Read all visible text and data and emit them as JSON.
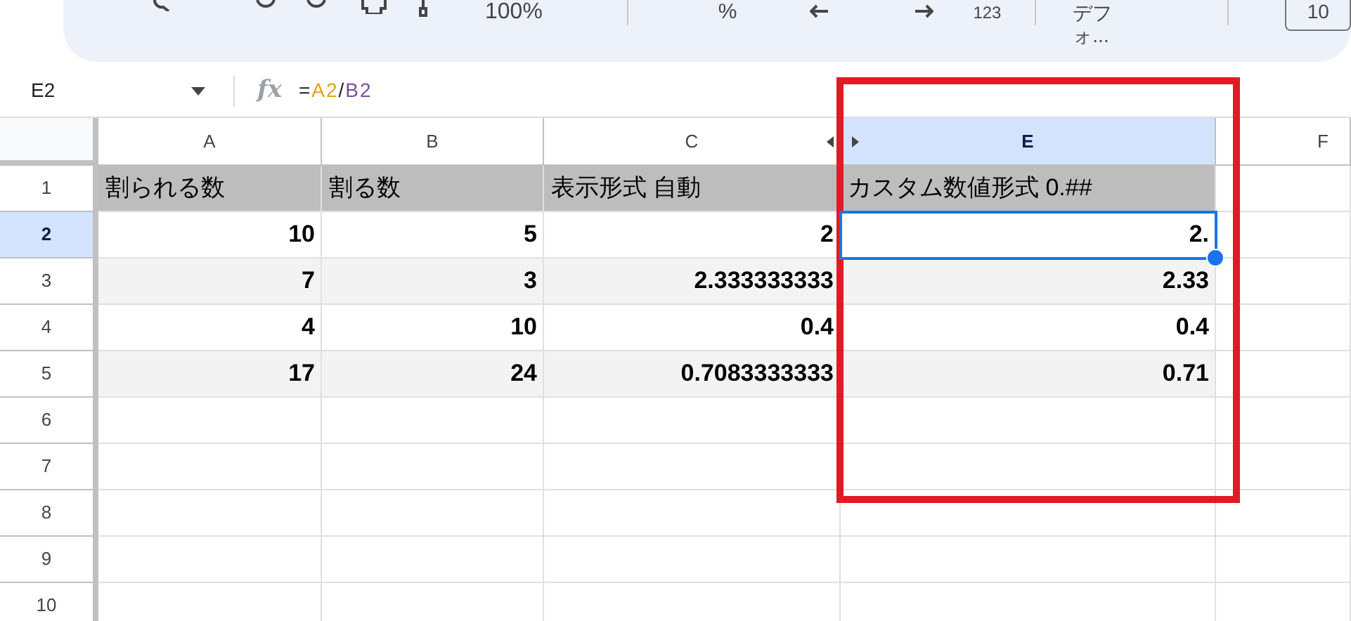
{
  "toolbar": {
    "zoom": "100%",
    "percent": "%",
    "number_format": "123",
    "font": "デフォ...",
    "font_size": "10"
  },
  "formula_bar": {
    "name_box": "E2",
    "function_label": "fx",
    "formula": [
      {
        "text": "=",
        "color": "#202124"
      },
      {
        "text": "A2",
        "color": "#e3a21a"
      },
      {
        "text": "/",
        "color": "#202124"
      },
      {
        "text": "B2",
        "color": "#7b4ca0"
      }
    ]
  },
  "columns": [
    {
      "letter": "A",
      "selected": false,
      "hidden_after": false,
      "hidden_before": false
    },
    {
      "letter": "B",
      "selected": false,
      "hidden_after": false,
      "hidden_before": false
    },
    {
      "letter": "C",
      "selected": false,
      "hidden_after": true,
      "hidden_before": false
    },
    {
      "letter": "E",
      "selected": true,
      "hidden_after": false,
      "hidden_before": true
    },
    {
      "letter": "F",
      "selected": false,
      "hidden_after": false,
      "hidden_before": false
    }
  ],
  "rows": [
    {
      "number": "1",
      "selected": false,
      "kind": "header",
      "cells": [
        {
          "value": "割られる数",
          "selected": false
        },
        {
          "value": "割る数",
          "selected": false
        },
        {
          "value": "表示形式 自動",
          "selected": false
        },
        {
          "value": "カスタム数値形式 0.##",
          "selected": false
        }
      ]
    },
    {
      "number": "2",
      "selected": true,
      "kind": "data",
      "banded": false,
      "cells": [
        {
          "value": "10",
          "selected": false
        },
        {
          "value": "5",
          "selected": false
        },
        {
          "value": "2",
          "selected": false
        },
        {
          "value": "2.",
          "selected": true
        }
      ]
    },
    {
      "number": "3",
      "selected": false,
      "kind": "data",
      "banded": true,
      "cells": [
        {
          "value": "7",
          "selected": false
        },
        {
          "value": "3",
          "selected": false
        },
        {
          "value": "2.333333333",
          "selected": false
        },
        {
          "value": "2.33",
          "selected": false
        }
      ]
    },
    {
      "number": "4",
      "selected": false,
      "kind": "data",
      "banded": false,
      "cells": [
        {
          "value": "4",
          "selected": false
        },
        {
          "value": "10",
          "selected": false
        },
        {
          "value": "0.4",
          "selected": false
        },
        {
          "value": "0.4",
          "selected": false
        }
      ]
    },
    {
      "number": "5",
      "selected": false,
      "kind": "data",
      "banded": true,
      "cells": [
        {
          "value": "17",
          "selected": false
        },
        {
          "value": "24",
          "selected": false
        },
        {
          "value": "0.7083333333",
          "selected": false
        },
        {
          "value": "0.71",
          "selected": false
        }
      ]
    },
    {
      "number": "6",
      "selected": false,
      "kind": "empty",
      "banded": false,
      "cells": []
    },
    {
      "number": "7",
      "selected": false,
      "kind": "empty",
      "banded": false,
      "cells": []
    },
    {
      "number": "8",
      "selected": false,
      "kind": "empty",
      "banded": false,
      "cells": []
    },
    {
      "number": "9",
      "selected": false,
      "kind": "empty",
      "banded": false,
      "cells": []
    },
    {
      "number": "10",
      "selected": false,
      "kind": "empty",
      "banded": false,
      "cells": []
    }
  ]
}
